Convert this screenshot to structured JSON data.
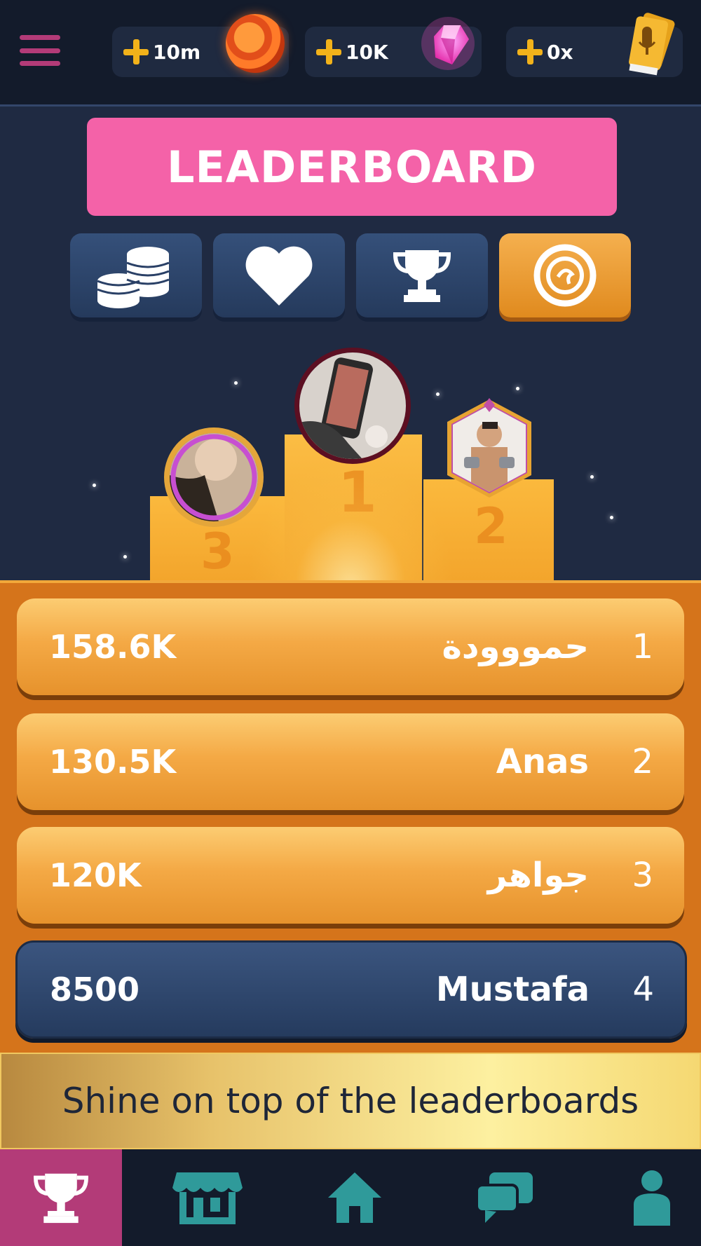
{
  "topbar": {
    "currencies": [
      {
        "amount": "10m",
        "icon": "coin-icon"
      },
      {
        "amount": "10K",
        "icon": "gem-icon"
      },
      {
        "amount": "0x",
        "icon": "microphone-ticket-icon"
      }
    ],
    "menu_icon": "hamburger-menu-icon"
  },
  "header": {
    "title": "LEADERBOARD"
  },
  "tabs": [
    {
      "icon": "coins-stack-icon",
      "active": false
    },
    {
      "icon": "heart-icon",
      "active": false
    },
    {
      "icon": "trophy-icon",
      "active": false
    },
    {
      "icon": "coin-emblem-icon",
      "active": true
    }
  ],
  "podium": {
    "first": {
      "rank": "1"
    },
    "second": {
      "rank": "2"
    },
    "third": {
      "rank": "3"
    }
  },
  "leaderboard": {
    "rows": [
      {
        "score": "158.6K",
        "name": "حمووودة",
        "position": "1"
      },
      {
        "score": "130.5K",
        "name": "Anas",
        "position": "2"
      },
      {
        "score": "120K",
        "name": "جواهر",
        "position": "3"
      }
    ],
    "me": {
      "score": "8500",
      "name": "Mustafa",
      "position": "4"
    }
  },
  "banner": {
    "text": "Shine on top of the leaderboards"
  },
  "bottom_nav": [
    {
      "icon": "trophy-icon",
      "active": true
    },
    {
      "icon": "store-icon",
      "active": false
    },
    {
      "icon": "home-icon",
      "active": false
    },
    {
      "icon": "chat-icon",
      "active": false
    },
    {
      "icon": "profile-icon",
      "active": false
    }
  ],
  "colors": {
    "background": "#1f2a42",
    "topbar": "#131b2b",
    "pink": "#f462a8",
    "orange": "#f4a945",
    "gold": "#f2b21a",
    "nav_active": "#b33b78",
    "icon_teal": "#2f9a9a"
  }
}
